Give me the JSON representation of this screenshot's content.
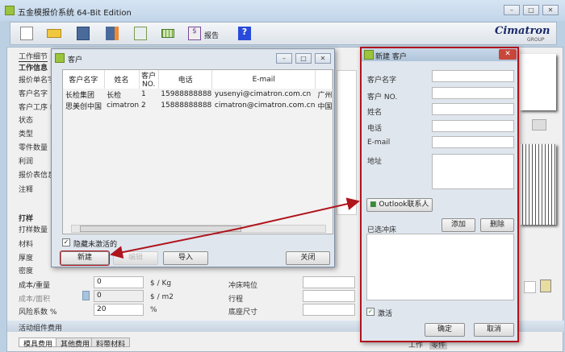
{
  "app": {
    "title": "五金模报价系统 64-Bit Edition",
    "logo": "Cimatron",
    "logo_sub": "GROUP"
  },
  "toolbar": {
    "report_label": "报告",
    "icons": [
      "new-file-icon",
      "open-folder-icon",
      "save-icon",
      "save-as-icon",
      "settings-icon",
      "grid-icon",
      "report-icon",
      "help-icon"
    ]
  },
  "form": {
    "tab": "工作细节",
    "section_job": "工作信息",
    "labels": [
      "报价单名字",
      "客户名字",
      "客户工序 NO",
      "状态",
      "类型",
      "零件数量",
      "利润",
      "报价表信息",
      "注释"
    ],
    "section_sample": "打样",
    "sample_labels": [
      "打样数量",
      "材料",
      "厚度",
      "密度"
    ],
    "cost_weight": {
      "label": "成本/重量",
      "value": "0",
      "unit": "$ / Kg"
    },
    "cost_area": {
      "label": "成本/面积",
      "value": "0",
      "unit": "$ / m2"
    },
    "risk": {
      "label": "风险系数 %",
      "value": "20",
      "unit": "%"
    },
    "right_labels": [
      "冲床吨位",
      "行程",
      "底座尺寸"
    ],
    "section_activity": "活动组件费用",
    "bottom_tabs": [
      "模具费用",
      "其他费用",
      "料带材料"
    ],
    "right_tabs": [
      "工作",
      "零件"
    ]
  },
  "customers_dialog": {
    "title": "客户",
    "columns": [
      "客户名字",
      "姓名",
      "客户 NO.",
      "电话",
      "E-mail",
      ""
    ],
    "rows": [
      [
        "长检集团",
        "长检",
        "1",
        "15988888888",
        "yusenyi@cimatron.com.cn",
        "广州"
      ],
      [
        "思美创中国",
        "cimatron",
        "2",
        "15888888888",
        "cimatron@cimatron.com.cn",
        "中国"
      ]
    ],
    "hide_inactive_label": "隐藏未激活的",
    "hide_inactive": true,
    "new_label": "新建",
    "edit_label": "编辑",
    "import_label": "导入",
    "close_label": "关闭"
  },
  "new_customer_dialog": {
    "title": "新建 客户",
    "fields": {
      "name": "客户名字",
      "no": "客户 NO.",
      "person": "姓名",
      "phone": "电话",
      "email": "E-mail",
      "address": "地址"
    },
    "outlook_label": "Outlook联系人",
    "presses_label": "已选冲床",
    "add_label": "添加",
    "delete_label": "删除",
    "active_label": "激活",
    "active": true,
    "ok_label": "确定",
    "cancel_label": "取消"
  },
  "colors": {
    "highlight": "#b0141c"
  }
}
